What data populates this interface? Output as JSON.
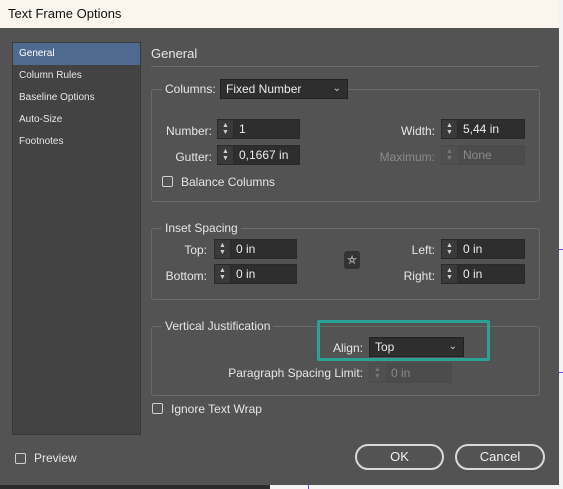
{
  "window": {
    "title": "Text Frame Options"
  },
  "sidebar": {
    "items": [
      {
        "label": "General",
        "active": true
      },
      {
        "label": "Column Rules"
      },
      {
        "label": "Baseline Options"
      },
      {
        "label": "Auto-Size"
      },
      {
        "label": "Footnotes"
      }
    ]
  },
  "general": {
    "title": "General",
    "columns": {
      "label": "Columns:",
      "type_value": "Fixed Number",
      "number_label": "Number:",
      "number_value": "1",
      "gutter_label": "Gutter:",
      "gutter_value": "0,1667 in",
      "width_label": "Width:",
      "width_value": "5,44 in",
      "maximum_label": "Maximum:",
      "maximum_value": "None",
      "balance_label": "Balance Columns",
      "balance_checked": false
    },
    "inset": {
      "title": "Inset Spacing",
      "top_label": "Top:",
      "top_value": "0 in",
      "bottom_label": "Bottom:",
      "bottom_value": "0 in",
      "left_label": "Left:",
      "left_value": "0 in",
      "right_label": "Right:",
      "right_value": "0 in"
    },
    "vertical": {
      "title": "Vertical Justification",
      "align_label": "Align:",
      "align_value": "Top",
      "para_label": "Paragraph Spacing Limit:",
      "para_value": "0 in"
    },
    "ignore_wrap_label": "Ignore Text Wrap",
    "ignore_wrap_checked": false
  },
  "footer": {
    "preview_label": "Preview",
    "preview_checked": false,
    "ok_label": "OK",
    "cancel_label": "Cancel"
  },
  "colors": {
    "dialog_bg": "#535353",
    "sidebar_active": "#4e6a8e",
    "highlight": "#2aa396"
  }
}
